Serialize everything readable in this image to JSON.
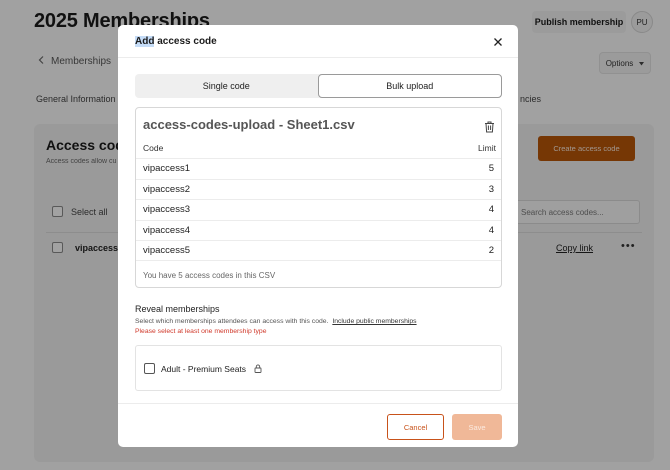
{
  "background": {
    "page_title": "2025 Memberships",
    "publish_label": "Publish membership",
    "avatar_initials": "PU",
    "back_label": "Memberships",
    "options_label": "Options",
    "tab_general": "General Information",
    "tab_partial": "ncies",
    "card_title": "Access code",
    "card_subtitle": "Access codes allow cu",
    "create_label": "Create access code",
    "select_all_label": "Select all",
    "search_placeholder": "Search access codes...",
    "row_name": "vipaccess",
    "copy_link_label": "Copy link"
  },
  "modal": {
    "title_highlight": "Add",
    "title_rest": " access code",
    "tabs": [
      {
        "label": "Single code",
        "active": false
      },
      {
        "label": "Bulk upload",
        "active": true
      }
    ],
    "csv": {
      "filename": "access-codes-upload - Sheet1.csv",
      "col_code": "Code",
      "col_limit": "Limit",
      "rows": [
        {
          "code": "vipaccess1",
          "limit": "5"
        },
        {
          "code": "vipaccess2",
          "limit": "3"
        },
        {
          "code": "vipaccess3",
          "limit": "4"
        },
        {
          "code": "vipaccess4",
          "limit": "4"
        },
        {
          "code": "vipaccess5",
          "limit": "2"
        }
      ],
      "summary": "You have 5 access codes in this CSV"
    },
    "reveal": {
      "title": "Reveal memberships",
      "description": "Select which memberships attendees can access with this code.",
      "link_label": "Include public memberships",
      "error": "Please select at least one membership type",
      "option_label": "Adult - Premium Seats"
    },
    "footer": {
      "cancel_label": "Cancel",
      "save_label": "Save"
    }
  },
  "colors": {
    "accent": "#c8521a",
    "accent_disabled": "#f0b898",
    "error": "#d0392b"
  }
}
